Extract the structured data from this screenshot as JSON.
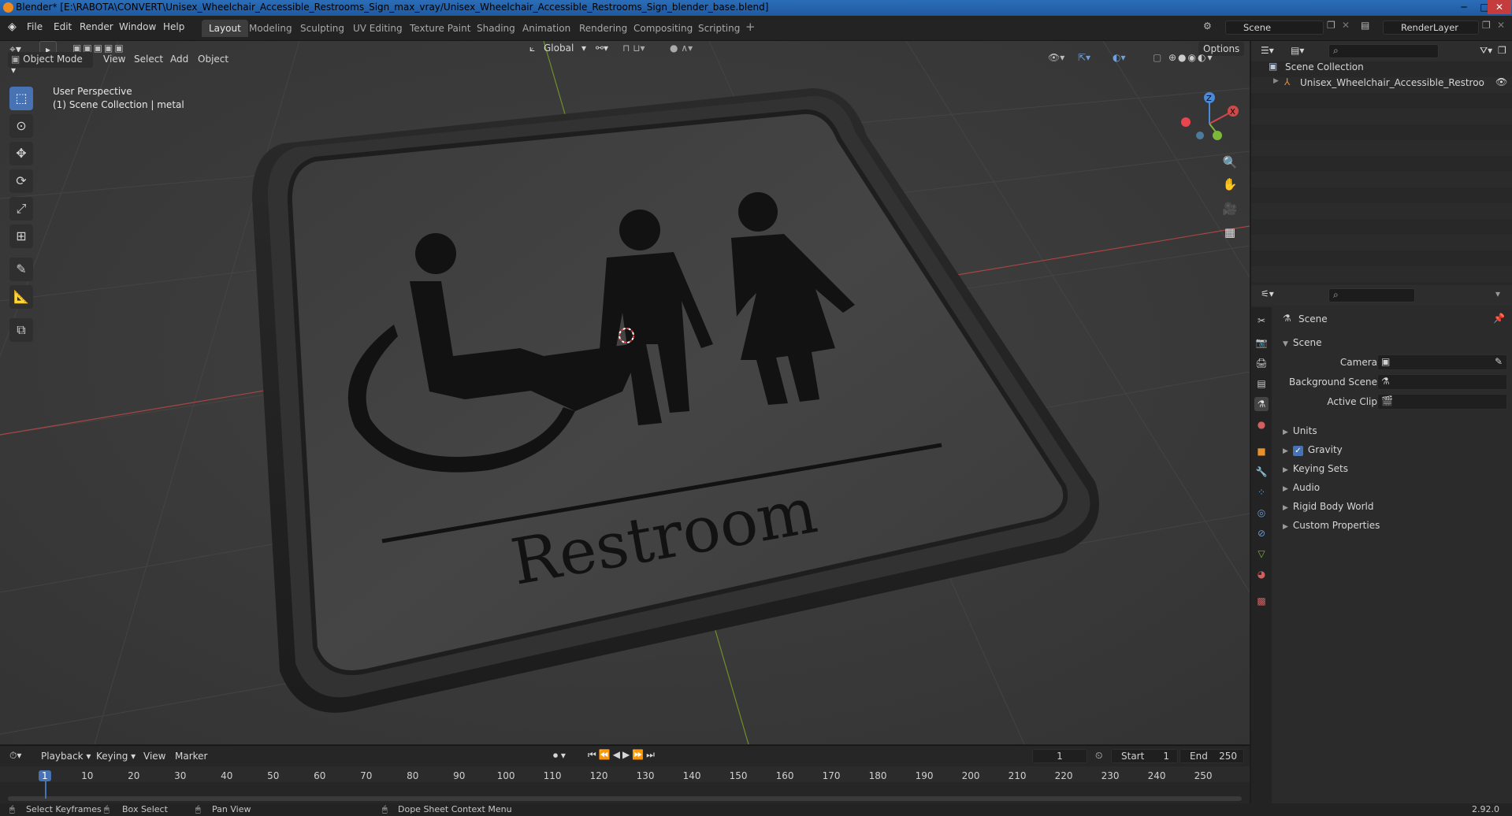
{
  "window": {
    "title": "Blender* [E:\\RABOTA\\CONVERT\\Unisex_Wheelchair_Accessible_Restrooms_Sign_max_vray/Unisex_Wheelchair_Accessible_Restrooms_Sign_blender_base.blend]",
    "minimize": "─",
    "maximize": "□",
    "close": "✕"
  },
  "menu": {
    "file": "File",
    "edit": "Edit",
    "render": "Render",
    "window": "Window",
    "help": "Help"
  },
  "workspaces": [
    "Layout",
    "Modeling",
    "Sculpting",
    "UV Editing",
    "Texture Paint",
    "Shading",
    "Animation",
    "Rendering",
    "Compositing",
    "Scripting"
  ],
  "workspace_add": "+",
  "scene_field": "Scene",
  "renderlayer_field": "RenderLayer",
  "viewport": {
    "mode": "Object Mode",
    "view": "View",
    "select": "Select",
    "add": "Add",
    "object": "Object",
    "orientation": "Global",
    "options": "Options",
    "info_line1": "User Perspective",
    "info_line2": "(1) Scene Collection | metal",
    "sign_text": "Restroom",
    "gizmo_z": "Z",
    "gizmo_x": "X"
  },
  "outliner": {
    "collection": "Scene Collection",
    "object": "Unisex_Wheelchair_Accessible_Restrooms_S"
  },
  "properties": {
    "breadcrumb": "Scene",
    "panel": "Scene",
    "camera_label": "Camera",
    "background_scene_label": "Background Scene",
    "active_clip_label": "Active Clip",
    "sections": [
      "Units",
      "Gravity",
      "Keying Sets",
      "Audio",
      "Rigid Body World",
      "Custom Properties"
    ],
    "gravity_checked": true
  },
  "timeline": {
    "playback": "Playback",
    "keying": "Keying",
    "view": "View",
    "marker": "Marker",
    "current_frame": "1",
    "start_label": "Start",
    "start": "1",
    "end_label": "End",
    "end": "250",
    "ticks": [
      "1",
      "10",
      "20",
      "30",
      "40",
      "50",
      "60",
      "70",
      "80",
      "90",
      "100",
      "110",
      "120",
      "130",
      "140",
      "150",
      "160",
      "170",
      "180",
      "190",
      "200",
      "210",
      "220",
      "230",
      "240",
      "250"
    ]
  },
  "status": {
    "select_keyframes": "Select Keyframes",
    "box_select": "Box Select",
    "pan_view": "Pan View",
    "context_menu": "Dope Sheet Context Menu",
    "version": "2.92.0"
  },
  "colors": {
    "accent": "#4772b3",
    "title_bar": "#2b6db8",
    "axis_x": "#c94a4a",
    "axis_y": "#7fa830"
  }
}
